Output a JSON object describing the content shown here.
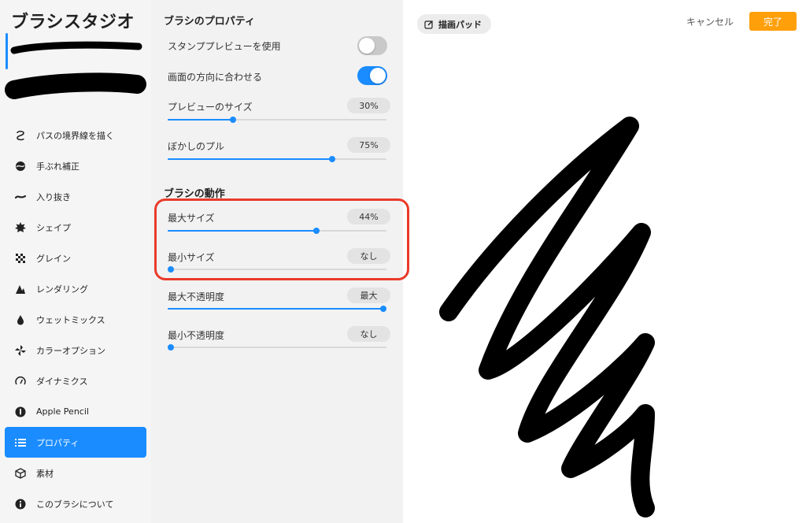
{
  "app": {
    "title": "ブラシスタジオ"
  },
  "sidebar": {
    "items": [
      {
        "label": "パスの境界線を描く",
        "icon": "stroke-path-icon",
        "active": false
      },
      {
        "label": "手ぶれ補正",
        "icon": "stabilization-icon",
        "active": false
      },
      {
        "label": "入り抜き",
        "icon": "taper-icon",
        "active": false
      },
      {
        "label": "シェイプ",
        "icon": "shape-icon",
        "active": false
      },
      {
        "label": "グレイン",
        "icon": "grain-icon",
        "active": false
      },
      {
        "label": "レンダリング",
        "icon": "rendering-icon",
        "active": false
      },
      {
        "label": "ウェットミックス",
        "icon": "wet-mix-icon",
        "active": false
      },
      {
        "label": "カラーオプション",
        "icon": "color-options-icon",
        "active": false
      },
      {
        "label": "ダイナミクス",
        "icon": "dynamics-icon",
        "active": false
      },
      {
        "label": "Apple Pencil",
        "icon": "apple-pencil-icon",
        "active": false
      },
      {
        "label": "プロパティ",
        "icon": "properties-icon",
        "active": true
      },
      {
        "label": "素材",
        "icon": "materials-icon",
        "active": false
      },
      {
        "label": "このブラシについて",
        "icon": "info-icon",
        "active": false
      }
    ]
  },
  "properties": {
    "preview_section_title": "ブラシのプロパティ",
    "stamp_preview": {
      "label": "スタンププレビューを使用",
      "on": false
    },
    "orient_to_screen": {
      "label": "画面の方向に合わせる",
      "on": true
    },
    "preview_size": {
      "label": "プレビューのサイズ",
      "value": "30%",
      "level": 0.3
    },
    "preview_blur": {
      "label": "ぼかしのプル",
      "value": "75%",
      "level": 0.75
    },
    "behavior_section_title": "ブラシの動作",
    "max_size": {
      "label": "最大サイズ",
      "value": "44%",
      "level": 0.68
    },
    "min_size": {
      "label": "最小サイズ",
      "value": "なし",
      "level": 0.0
    },
    "max_opacity": {
      "label": "最大不透明度",
      "value": "最大",
      "level": 1.0
    },
    "min_opacity": {
      "label": "最小不透明度",
      "value": "なし",
      "level": 0.0
    }
  },
  "pad": {
    "chip_label": "描画パッド",
    "cancel_label": "キャンセル",
    "done_label": "完了"
  },
  "colors": {
    "accent": "#1a8cff",
    "done": "#ff9f0a",
    "highlight": "#ea3a2a"
  }
}
